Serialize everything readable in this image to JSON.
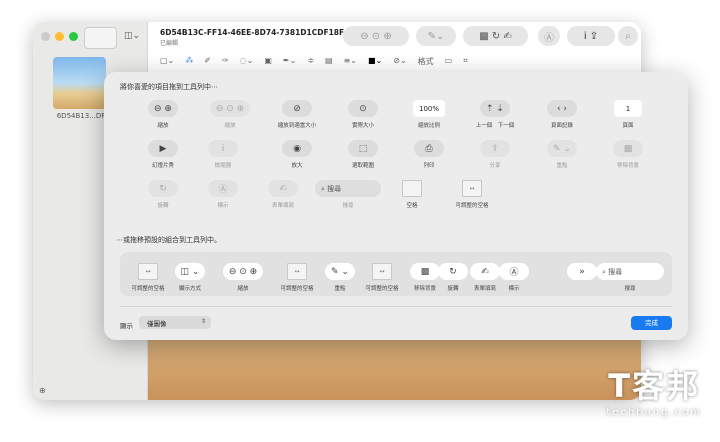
{
  "window": {
    "doc_title": "6D54B13C-FF14-46EE-8D74-7381D1CDF18F...",
    "doc_subtitle": "已編輯",
    "thumbnail_label": "6D54B13...DF",
    "markup_format_label": "格式"
  },
  "sheet": {
    "drag_prompt": "將你喜愛的項目拖到工具列中⋯",
    "default_prompt": "⋯或拖移預設的組合到工具列中。",
    "items": [
      {
        "id": "zoom",
        "label": "縮放",
        "icon": "⊖ ⊕",
        "dim": false
      },
      {
        "id": "zoom-3",
        "label": "縮放",
        "icon": "⊖ ⊙ ⊕",
        "dim": true
      },
      {
        "id": "zoom-to-fit",
        "label": "縮放到適當大小",
        "icon": "⊘",
        "dim": false
      },
      {
        "id": "actual-size",
        "label": "實際大小",
        "icon": "⊙",
        "dim": false
      },
      {
        "id": "zoom-percent",
        "label": "縮放比例",
        "icon": "100%",
        "dim": false
      },
      {
        "id": "prev-next",
        "label": "上一個　下一個",
        "icon": "⇡ ⇣",
        "dim": false
      },
      {
        "id": "history",
        "label": "頁面記錄",
        "icon": "‹ ›",
        "dim": false
      },
      {
        "id": "page",
        "label": "頁面",
        "icon": "1",
        "dim": false
      },
      {
        "id": "slideshow",
        "label": "幻燈片秀",
        "icon": "▶",
        "dim": false
      },
      {
        "id": "inspector",
        "label": "檢閱器",
        "icon": "i",
        "dim": true
      },
      {
        "id": "magnifier",
        "label": "放大",
        "icon": "◉",
        "dim": false
      },
      {
        "id": "selection",
        "label": "選取範圍",
        "icon": "⬚",
        "dim": false
      },
      {
        "id": "print",
        "label": "列印",
        "icon": "⎙",
        "dim": false
      },
      {
        "id": "share",
        "label": "分享",
        "icon": "⇪",
        "dim": true
      },
      {
        "id": "highlight",
        "label": "重點",
        "icon": "✎ ⌄",
        "dim": true
      },
      {
        "id": "remove-bg",
        "label": "移除背景",
        "icon": "▩",
        "dim": true
      },
      {
        "id": "rotate",
        "label": "旋轉",
        "icon": "↻",
        "dim": true
      },
      {
        "id": "markup",
        "label": "標示",
        "icon": "Ⓐ",
        "dim": true
      },
      {
        "id": "form-fill",
        "label": "表單填寫",
        "icon": "✍",
        "dim": true
      },
      {
        "id": "search",
        "label": "搜尋",
        "icon": "⌕ 搜尋",
        "dim": true
      },
      {
        "id": "space",
        "label": "空格",
        "icon": "",
        "dim": false
      },
      {
        "id": "flex-space",
        "label": "可調整的空格",
        "icon": "↔",
        "dim": false
      }
    ],
    "defaults": [
      {
        "id": "flex-space",
        "label": "可調整的空格",
        "icon": "↔"
      },
      {
        "id": "view-mode",
        "label": "顯示方式",
        "icon": "◫ ⌄"
      },
      {
        "id": "zoom",
        "label": "縮放",
        "icon": "⊖ ⊙ ⊕"
      },
      {
        "id": "flex-space",
        "label": "可調整的空格",
        "icon": "↔"
      },
      {
        "id": "highlight",
        "label": "重點",
        "icon": "✎ ⌄"
      },
      {
        "id": "flex-space",
        "label": "可調整的空格",
        "icon": "↔"
      },
      {
        "id": "remove-bg",
        "label": "移除背景",
        "icon": "▩"
      },
      {
        "id": "rotate",
        "label": "旋轉",
        "icon": "↻"
      },
      {
        "id": "form-fill",
        "label": "表單填寫",
        "icon": "✍"
      },
      {
        "id": "markup",
        "label": "標示",
        "icon": "Ⓐ"
      },
      {
        "id": "overflow",
        "label": "",
        "icon": "»"
      },
      {
        "id": "search",
        "label": "搜尋",
        "icon": "⌕ 搜尋"
      }
    ],
    "show_label": "顯示",
    "show_value": "僅圖像",
    "done_label": "完成"
  },
  "watermark": {
    "big": "T客邦",
    "small": "techbang.com"
  },
  "colors": {
    "accent": "#1a7bf0",
    "close": "#fe5f57",
    "minimize": "#febc2e",
    "zoom": "#28c840"
  }
}
